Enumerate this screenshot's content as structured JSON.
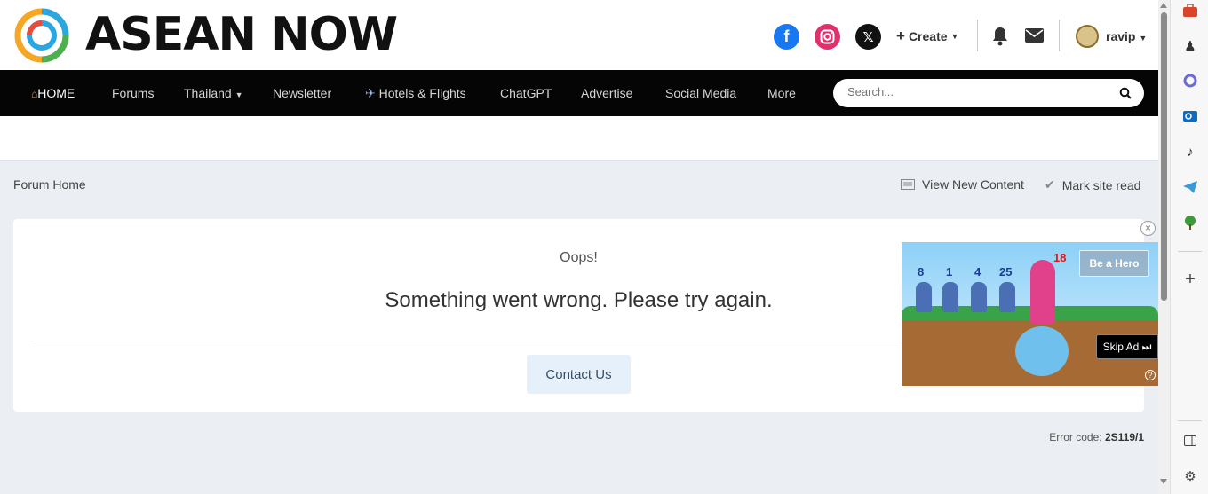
{
  "header": {
    "logo_text": "ASEAN NOW",
    "create_label": "Create",
    "username": "ravip"
  },
  "nav": {
    "items": [
      {
        "label": "HOME"
      },
      {
        "label": "Forums"
      },
      {
        "label": "Thailand"
      },
      {
        "label": "Newsletter"
      },
      {
        "label": "Hotels & Flights"
      },
      {
        "label": "ChatGPT"
      },
      {
        "label": "Advertise"
      },
      {
        "label": "Social Media"
      },
      {
        "label": "More"
      }
    ],
    "search_placeholder": "Search..."
  },
  "breadcrumb": {
    "home": "Forum Home"
  },
  "page_actions": {
    "view_new": "View New Content",
    "mark_read": "Mark site read"
  },
  "error": {
    "title": "Oops!",
    "message": "Something went wrong. Please try again.",
    "contact_button": "Contact Us",
    "code_label": "Error code:",
    "code_value": "2S119/1"
  },
  "ad": {
    "numbers": [
      "8",
      "1",
      "4",
      "25"
    ],
    "age_badge": "18",
    "cta": "Be a Hero",
    "skip": "Skip Ad ⏭",
    "help": "?"
  },
  "colors": {
    "nav_bg": "#050505",
    "page_bg": "#ebeef2",
    "contact_bg": "#e6f0fa",
    "facebook": "#1877f2",
    "instagram": "#e1306c"
  }
}
